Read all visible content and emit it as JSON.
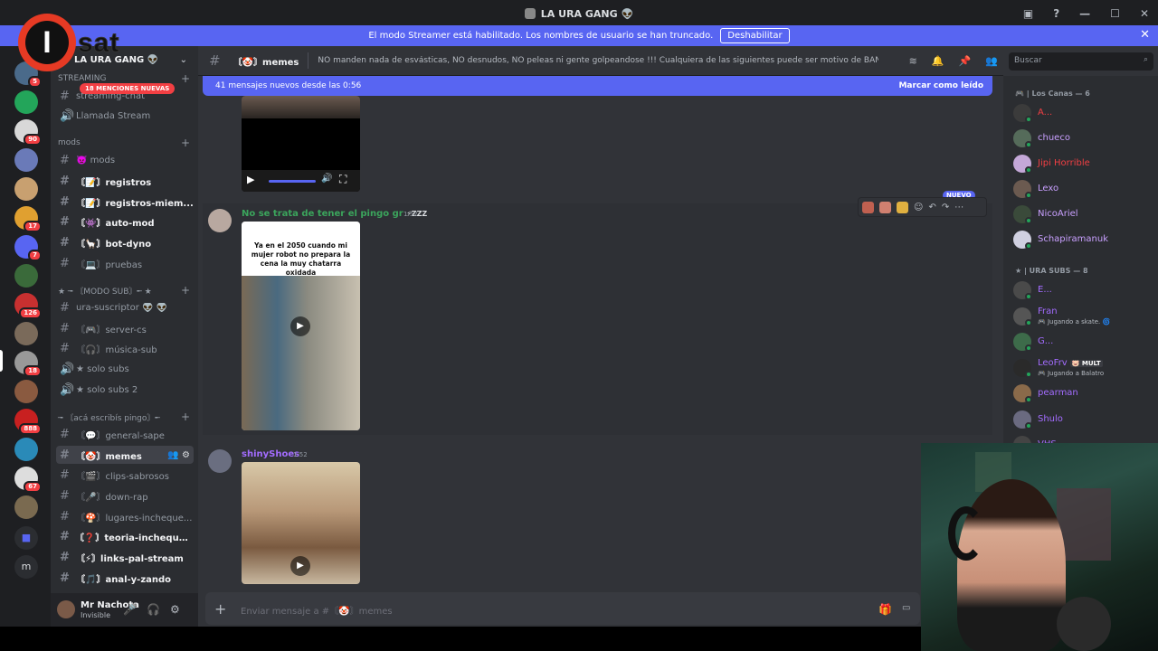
{
  "window": {
    "title": "LA URA GANG 👽"
  },
  "banner": {
    "text": "El modo Streamer está habilitado. Los nombres de usuario se han truncado.",
    "button": "Deshabilitar",
    "close": "✕"
  },
  "logo": {
    "mark": "I",
    "text": "sat"
  },
  "rail": {
    "badges": [
      "5",
      "90",
      "17",
      "7",
      "126",
      "18",
      "888",
      "67"
    ],
    "letter": "m"
  },
  "sidebar": {
    "server_name": "LA URA GANG 👽",
    "mentions": "18 MENCIONES NUEVAS",
    "categories": {
      "streaming": "STREAMING",
      "mods": "mods",
      "modo_sub": "★ ╼ 〘MODO SUB〙╾ ★",
      "aca": "╼ 〘acá escribís pingo〙╾"
    },
    "channels": {
      "streaming_chat": "streaming-chat",
      "llamada": "Llamada Stream",
      "mods": "👿 mods",
      "registros": "〘📝〙registros",
      "registros_miem": "〘📝〙registros-miem...",
      "auto_mod": "〘👾〙auto-mod",
      "bot_dyno": "〘🦙〙bot-dyno",
      "pruebas": "〘💻〙pruebas",
      "ura_suscriptor": "ura-suscriptor 👽 👽",
      "server_cs": "〘🎮〙server-cs",
      "musica_sub": "〘🎧〙música-sub",
      "solo_subs": "★ solo subs",
      "solo_subs_2": "★ solo subs 2",
      "general_sape": "〘💬〙general-sape",
      "memes": "〘🤡〙memes",
      "clips": "〘🎬〙clips-sabrosos",
      "down_rap": "〘🎤〙down-rap",
      "lugares": "〘🍄〙lugares-incheque...",
      "teoria": "〘❓〙teoria-inchequea...",
      "links": "〘⚡〙links-pal-stream",
      "anal": "〘🎵〙anal-y-zando"
    }
  },
  "user": {
    "name": "Mr Nachota",
    "status": "Invisible"
  },
  "header": {
    "channel": "〘🤡〙memes",
    "topic": "NO manden nada de esvásticas, NO desnudos, NO peleas ni gente golpeandose !!! Cualquiera de las siguientes puede ser motivo de BAN, cuiden el stream!"
  },
  "search": {
    "placeholder": "Buscar"
  },
  "new_messages": {
    "text": "41 mensajes nuevos desde las 0:56",
    "mark_read": "Marcar como leído"
  },
  "messages": [
    {
      "author": "No se trata de tener el pingo gr",
      "author_badge": "⚡ZZZ",
      "time": "1:52",
      "new_tag": "NUEVO",
      "caption": "Ya en el 2050 cuando mi mujer robot no prepara la cena la muy chatarra oxidada"
    },
    {
      "author": "shinyShoes",
      "time": "1:52"
    }
  ],
  "composer": {
    "placeholder": "Enviar mensaje a #〘🤡〙memes"
  },
  "members": {
    "group1": "🎮 | Los Canas — 6",
    "group2": "★ | URA SUBS — 8",
    "list1": [
      {
        "name": "A...",
        "color": "#f23f43",
        "avatar": "#3b3b3b"
      },
      {
        "name": "chueco",
        "color": "#c9a0ff",
        "avatar": "#556b5a"
      },
      {
        "name": "Jipi Horrible",
        "color": "#f23f43",
        "avatar": "#c4a8d8"
      },
      {
        "name": "Lexo",
        "color": "#c9a0ff",
        "avatar": "#6b5a50"
      },
      {
        "name": "NicoAriel",
        "color": "#c9a0ff",
        "avatar": "#3a4a3a"
      },
      {
        "name": "Schapiramanuk",
        "color": "#c9a0ff",
        "avatar": "#d0d0e0"
      }
    ],
    "list2": [
      {
        "name": "E...",
        "color": "#a36cff",
        "avatar": "#4a4a4a"
      },
      {
        "name": "Fran",
        "color": "#a36cff",
        "avatar": "#555",
        "activity": "🎮 Jugando a skate. 🌀"
      },
      {
        "name": "G...",
        "color": "#a36cff",
        "avatar": "#3d6b4a"
      },
      {
        "name": "LeoFrv",
        "color": "#a36cff",
        "avatar": "#2a2a2a",
        "tag": "🐷 MULT",
        "activity": "🎮 Jugando a Balatro"
      },
      {
        "name": "pearman",
        "color": "#a36cff",
        "avatar": "#8a6a4a"
      },
      {
        "name": "Shulo",
        "color": "#a36cff",
        "avatar": "#6a6a80"
      },
      {
        "name": "VHS",
        "color": "#a36cff",
        "avatar": "#444"
      }
    ]
  },
  "colors": {
    "blurple": "#5865f2",
    "chat_bg": "#313338",
    "sidebar_bg": "#2b2d31",
    "rail_bg": "#1e1f22",
    "online": "#23a55a",
    "author_green": "#3ba55c",
    "author_purple": "#a36cff"
  }
}
